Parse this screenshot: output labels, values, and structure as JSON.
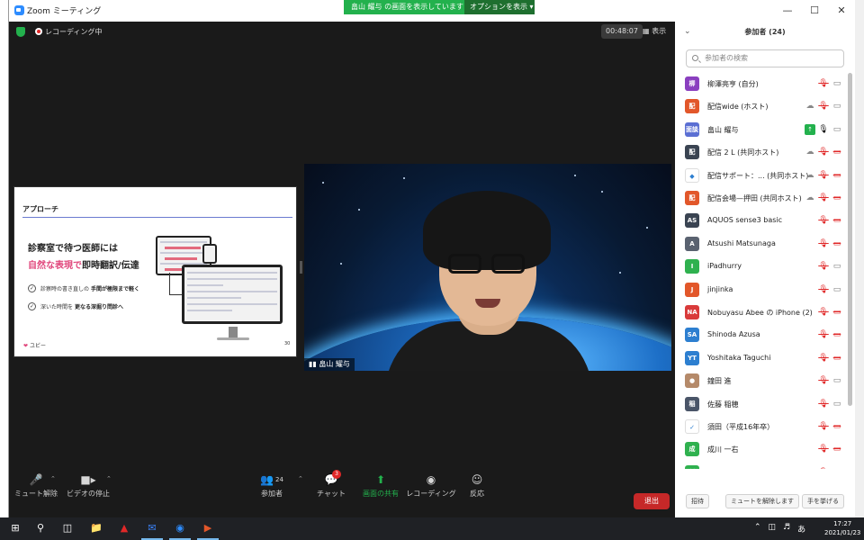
{
  "window": {
    "title": "Zoom ミーティング",
    "controls": [
      "minimize",
      "maximize",
      "close"
    ]
  },
  "share_banner": {
    "text": "畠山 耀与 の画面を表示しています",
    "options_label": "オプションを表示"
  },
  "meeting": {
    "recording_label": "レコーディング中",
    "timer": "00:48:07",
    "view_label": "表示"
  },
  "slide": {
    "heading": "アプローチ",
    "line1": "診察室で待つ医師には",
    "line2_pink": "自然な表現で",
    "line2_rest": "即時翻訳/伝達",
    "bullet1_plain": "診察時の書き直しの",
    "bullet1_bold": "手間が極限まで軽く",
    "bullet2_plain": "深いた時間を",
    "bullet2_bold": "更なる深掘り問診へ",
    "brand": "ユビー",
    "page": "30"
  },
  "video": {
    "name": "畠山 耀与"
  },
  "toolbar": {
    "mute_label": "ミュート解除",
    "video_label": "ビデオの停止",
    "participants_label": "参加者",
    "participants_count": "24",
    "chat_label": "チャット",
    "chat_badge": "3",
    "share_label": "画面の共有",
    "record_label": "レコーディング",
    "reactions_label": "反応",
    "leave_label": "退出"
  },
  "panel": {
    "title": "参加者 (24)",
    "search_placeholder": "参加者の検索",
    "participants": [
      {
        "avatar": "柳",
        "color": "#8a3fbf",
        "name": "柳澤亮亨 (自分)",
        "icons": [
          "mutemic",
          "vid"
        ]
      },
      {
        "avatar": "配",
        "color": "#e2572a",
        "name": "配信wide (ホスト)",
        "icons": [
          "cloud",
          "mutemic",
          "vid"
        ]
      },
      {
        "avatar": "面談",
        "color": "#5b6fd3",
        "name": "畠山 耀与",
        "icons": [
          "share",
          "mic",
          "vid"
        ]
      },
      {
        "avatar": "配",
        "color": "#3a4452",
        "name": "配信 2 L (共同ホスト)",
        "icons": [
          "cloud",
          "mutemic",
          "vidoff"
        ]
      },
      {
        "avatar": "◆",
        "color": "#ffffff",
        "name": "配信サポート：... (共同ホスト)",
        "icons": [
          "cloud",
          "mutemic",
          "vidoff"
        ]
      },
      {
        "avatar": "配",
        "color": "#e2572a",
        "name": "配信会場—押田 (共同ホスト)",
        "icons": [
          "cloud",
          "mutemic",
          "vidoff"
        ]
      },
      {
        "avatar": "AS",
        "color": "#3a4452",
        "name": "AQUOS sense3 basic",
        "icons": [
          "mutemic",
          "vidoff"
        ]
      },
      {
        "avatar": "A",
        "color": "#5a6270",
        "name": "Atsushi Matsunaga",
        "icons": [
          "mutemic",
          "vidoff"
        ]
      },
      {
        "avatar": "I",
        "color": "#2fb14f",
        "name": "iPadhurry",
        "icons": [
          "mutemic",
          "vid"
        ]
      },
      {
        "avatar": "J",
        "color": "#e2572a",
        "name": "jinjinka",
        "icons": [
          "mutemic",
          "vid"
        ]
      },
      {
        "avatar": "NA",
        "color": "#d93b3b",
        "name": "Nobuyasu Abee の iPhone (2)",
        "icons": [
          "mutemic",
          "vidoff"
        ]
      },
      {
        "avatar": "SA",
        "color": "#2d7fd0",
        "name": "Shinoda Azusa",
        "icons": [
          "mutemic",
          "vidoff"
        ]
      },
      {
        "avatar": "YT",
        "color": "#2d7fd0",
        "name": "Yoshitaka Taguchi",
        "icons": [
          "mutemic",
          "vidoff"
        ]
      },
      {
        "avatar": "●",
        "color": "#b58a6a",
        "name": "鐘田 進",
        "icons": [
          "mutemic",
          "vid"
        ]
      },
      {
        "avatar": "稲",
        "color": "#4a5568",
        "name": "佐藤 稲穂",
        "icons": [
          "mutemic",
          "vid"
        ]
      },
      {
        "avatar": "✓",
        "color": "#ffffff",
        "name": "須田（平成16年卒）",
        "icons": [
          "mutemic",
          "vidoff"
        ]
      },
      {
        "avatar": "成",
        "color": "#2fb14f",
        "name": "成川 一右",
        "icons": [
          "mutemic",
          "vidoff"
        ]
      },
      {
        "avatar": "村",
        "color": "#2fb14f",
        "name": "村山 公士",
        "icons": [
          "mutemic",
          "vid"
        ]
      }
    ],
    "footer": {
      "invite_label": "招待",
      "unmute_label": "ミュートを解除します",
      "raise_hand_label": "手を挙げる"
    }
  },
  "taskbar": {
    "time": "17:27",
    "date": "2021/01/23",
    "ime": "あ"
  },
  "colors": {
    "zoom_blue": "#2d8cff",
    "share_green": "#23b14d",
    "leave_red": "#c62828"
  }
}
